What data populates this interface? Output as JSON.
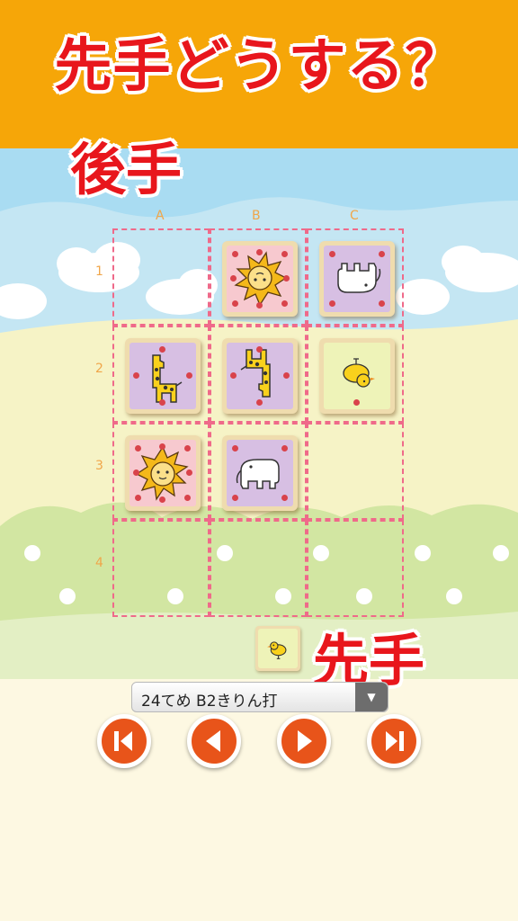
{
  "banner": {
    "title": "先手どうする？"
  },
  "players": {
    "gote_label": "後手",
    "sente_label": "先手"
  },
  "board": {
    "columns": [
      "A",
      "B",
      "C"
    ],
    "rows": [
      "1",
      "2",
      "3",
      "4"
    ],
    "pieces": [
      {
        "square": "B1",
        "animal": "lion",
        "owner": "gote"
      },
      {
        "square": "C1",
        "animal": "elephant",
        "owner": "gote"
      },
      {
        "square": "A2",
        "animal": "giraffe",
        "owner": "sente"
      },
      {
        "square": "B2",
        "animal": "giraffe",
        "owner": "gote"
      },
      {
        "square": "C2",
        "animal": "chick",
        "owner": "gote"
      },
      {
        "square": "A3",
        "animal": "lion",
        "owner": "sente"
      },
      {
        "square": "B3",
        "animal": "elephant",
        "owner": "sente"
      }
    ]
  },
  "sente_hand": [
    {
      "animal": "chick"
    }
  ],
  "move_select": {
    "value": "24てめ B2きりん打"
  },
  "controls": {
    "icons": [
      "skip-to-start-icon",
      "step-back-icon",
      "step-forward-icon",
      "skip-to-end-icon"
    ]
  },
  "colors": {
    "banner": "#f6a608",
    "title_red": "#e8161c",
    "lion_face": "#f7c9cf",
    "giraffe_face": "#d7bfe3",
    "elephant_face": "#d7bfe3",
    "chick_face": "#eef3b8",
    "button_orange": "#e8541a"
  }
}
